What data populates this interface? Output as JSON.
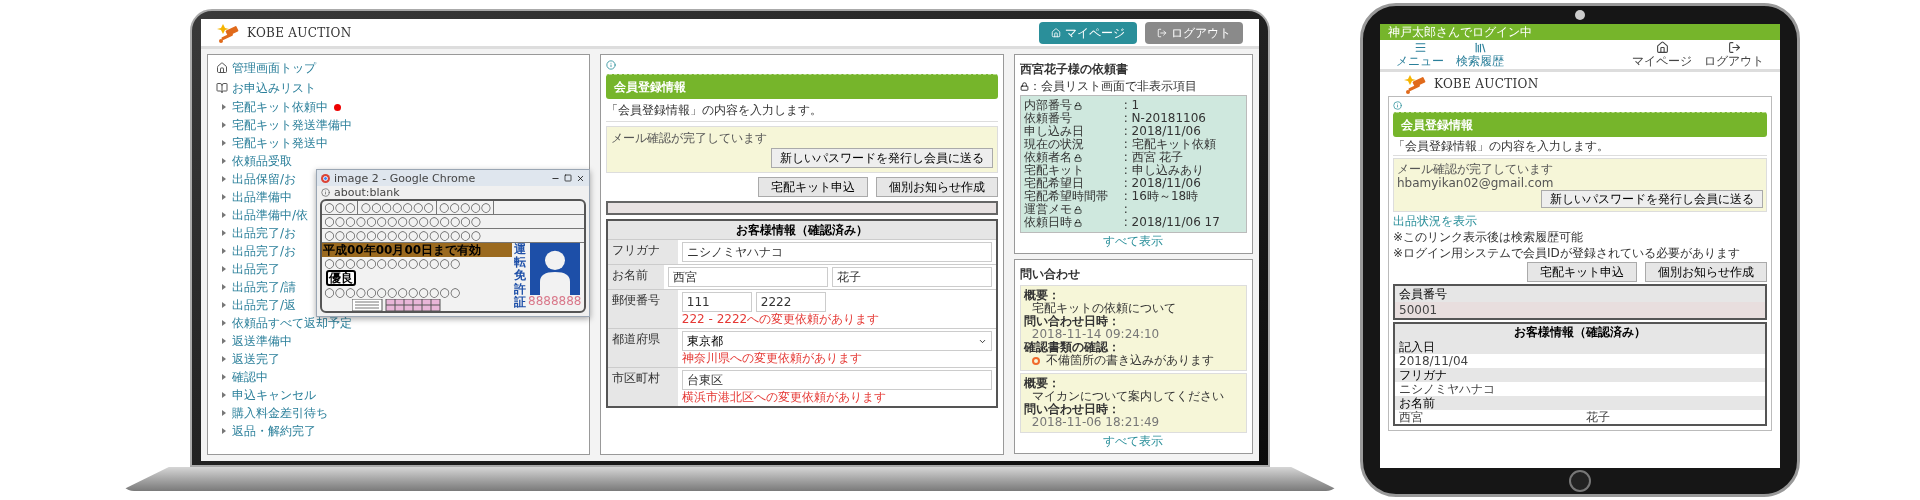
{
  "laptop": {
    "header": {
      "logo": "KOBE AUCTION",
      "buttons": [
        {
          "label": "マイページ",
          "kind": "home"
        },
        {
          "label": "ログアウト",
          "kind": "logout"
        }
      ]
    },
    "sidebar": {
      "top": "管理画面トップ",
      "list_title": "お申込みリスト",
      "items": [
        {
          "label": "宅配キット依頼中",
          "alert": true
        },
        {
          "label": "宅配キット発送準備中",
          "alert": false
        },
        {
          "label": "宅配キット発送中",
          "alert": false
        },
        {
          "label": "依頼品受取",
          "alert": false
        },
        {
          "label": "出品保留/お",
          "alert": false
        },
        {
          "label": "出品準備中",
          "alert": false
        },
        {
          "label": "出品準備中/依",
          "alert": false
        },
        {
          "label": "出品完了/お",
          "alert": false
        },
        {
          "label": "出品完了/お",
          "alert": false
        },
        {
          "label": "出品完了",
          "alert": false
        },
        {
          "label": "出品完了/請",
          "alert": false
        },
        {
          "label": "出品完了/返",
          "alert": false
        },
        {
          "label": "依頼品すべて返却予定",
          "alert": false
        },
        {
          "label": "返送準備中",
          "alert": false
        },
        {
          "label": "返送完了",
          "alert": false
        },
        {
          "label": "確認中",
          "alert": false
        },
        {
          "label": "申込キャンセル",
          "alert": false
        },
        {
          "label": "購入料金差引待ち",
          "alert": false
        },
        {
          "label": "返品・解約完了",
          "alert": false
        }
      ]
    },
    "popup": {
      "title": "image 2 - Google Chrome",
      "address": "about:blank",
      "card": {
        "top_cells": [
          "○○○",
          "○○○○○○○",
          "○○○○○"
        ],
        "lines": [
          "○○○○○○○○○○○○○○○",
          "○○○○○○○○○○○○○○○"
        ],
        "validity": "平成00年00月00日まで有効",
        "line_after": "○○○○○○○○○○○○○",
        "grade": "優良",
        "line_bottom": "○○○○○○○○○○○○○",
        "vertical_title": "運転免許証",
        "number": "8888888"
      }
    },
    "main": {
      "title": "会員登録情報",
      "intro": "「会員登録情報」の内容を入力します。",
      "notice": {
        "message": "メール確認が完了しています",
        "button": "新しいパスワードを発行し会員に送る"
      },
      "actions": [
        "宅配キット申込",
        "個別お知らせ作成"
      ],
      "table": {
        "title": "お客様情報（確認済み）",
        "rows": [
          {
            "label": "フリガナ",
            "fields": [
              {
                "value": "ニシノミヤハナコ",
                "kind": "text"
              }
            ]
          },
          {
            "label": "お名前",
            "fields": [
              {
                "value": "西宮",
                "kind": "text"
              },
              {
                "value": "花子",
                "kind": "text"
              }
            ]
          },
          {
            "label": "郵便番号",
            "fields": [
              {
                "value": "111",
                "kind": "short"
              },
              {
                "value": "2222",
                "kind": "short"
              }
            ],
            "note": "222 - 2222への変更依頼があります"
          },
          {
            "label": "都道府県",
            "fields": [
              {
                "value": "東京都",
                "kind": "select"
              }
            ],
            "note": "神奈川県への変更依頼があります"
          },
          {
            "label": "市区町村",
            "fields": [
              {
                "value": "台東区",
                "kind": "text"
              }
            ],
            "note": "横浜市港北区への変更依頼があります"
          }
        ]
      }
    },
    "right": {
      "request": {
        "title": "西宮花子様の依頼書",
        "note": "：会員リスト画面で非表示項目",
        "rows": [
          {
            "label": "内部番号",
            "locked": true,
            "value": ": 1"
          },
          {
            "label": "依頼番号",
            "locked": false,
            "value": ": N-20181106"
          },
          {
            "label": "申し込み日",
            "locked": false,
            "value": ": 2018/11/06"
          },
          {
            "label": "現在の状況",
            "locked": false,
            "value": ": 宅配キット依頼"
          },
          {
            "label": "依頼者名",
            "locked": true,
            "value": ": 西宮 花子"
          },
          {
            "label": "宅配キット",
            "locked": false,
            "value": ": 申し込みあり"
          },
          {
            "label": "宅配希望日",
            "locked": false,
            "value": ": 2018/11/06"
          },
          {
            "label": "宅配希望時間帯",
            "locked": false,
            "value": ": 16時～18時"
          },
          {
            "label": "運営メモ",
            "locked": true,
            "value": ":"
          },
          {
            "label": "依頼日時",
            "locked": true,
            "value": ": 2018/11/06 17"
          }
        ],
        "more": "すべて表示"
      },
      "inquiries": {
        "title": "問い合わせ",
        "items": [
          {
            "lines": [
              {
                "kind": "label",
                "text": "概要："
              },
              {
                "kind": "text",
                "text": "宅配キットの依頼について"
              },
              {
                "kind": "label",
                "text": "問い合わせ日時："
              },
              {
                "kind": "date",
                "text": "2018-11-14 09:24:10"
              },
              {
                "kind": "label",
                "text": "確認書類の確認："
              },
              {
                "kind": "warning",
                "text": "不備箇所の書き込みがあります"
              }
            ]
          },
          {
            "lines": [
              {
                "kind": "label",
                "text": "概要："
              },
              {
                "kind": "text",
                "text": "マイカンについて案内してください"
              },
              {
                "kind": "label",
                "text": "問い合わせ日時："
              },
              {
                "kind": "date",
                "text": "2018-11-06 18:21:49"
              }
            ]
          }
        ],
        "more": "すべて表示"
      }
    }
  },
  "tablet": {
    "status": "神戸太郎さんでログイン中",
    "nav": {
      "left": [
        {
          "label": "メニュー",
          "kind": "menu"
        },
        {
          "label": "検索履歴",
          "kind": "books"
        }
      ],
      "right": [
        {
          "label": "マイページ",
          "kind": "home"
        },
        {
          "label": "ログアウト",
          "kind": "logout"
        }
      ]
    },
    "logo": "KOBE AUCTION",
    "main": {
      "title": "会員登録情報",
      "intro": "「会員登録情報」の内容を入力します。",
      "notice": {
        "message": "メール確認が完了しています",
        "email": "hbamyikan02@gmail.com",
        "button": "新しいパスワードを発行し会員に送る"
      },
      "link": "出品状況を表示",
      "notes": [
        "※このリンク表示後は検索履歴可能",
        "※ログイン用システムで会員IDが登録されている必要があります"
      ],
      "actions": [
        "宅配キット申込",
        "個別お知らせ作成"
      ],
      "member": {
        "label": "会員番号",
        "value": "50001"
      },
      "table": {
        "title": "お客様情報（確認済み）",
        "rows": [
          {
            "label": "記入日",
            "values": [
              "2018/11/04"
            ]
          },
          {
            "label": "フリガナ",
            "values": [
              "ニシノミヤハナコ"
            ]
          },
          {
            "label": "お名前",
            "values": [
              "西宮",
              "花子"
            ]
          }
        ]
      }
    }
  }
}
